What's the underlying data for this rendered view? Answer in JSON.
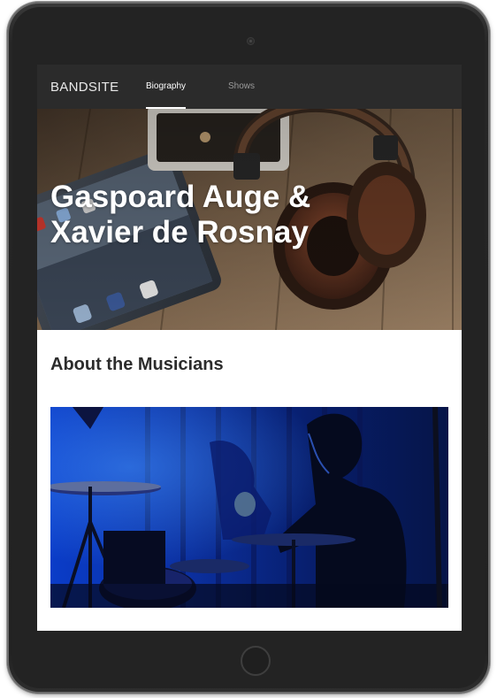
{
  "navbar": {
    "brand": "BANDSITE",
    "links": [
      {
        "label": "Biography",
        "active": true
      },
      {
        "label": "Shows",
        "active": false
      }
    ]
  },
  "hero": {
    "title_line1": "Gaspoard Auge &",
    "title_line2": "Xavier de Rosnay",
    "image_subject": "tablet and headphones on wooden table"
  },
  "about": {
    "heading": "About the Musicians",
    "image_subject": "drummer on stage in blue light"
  },
  "colors": {
    "navbar_bg": "#2b2b2b",
    "device_frame": "#232323",
    "heading_text": "#2c2c2c",
    "stage_blue": "#0b3fd1"
  }
}
